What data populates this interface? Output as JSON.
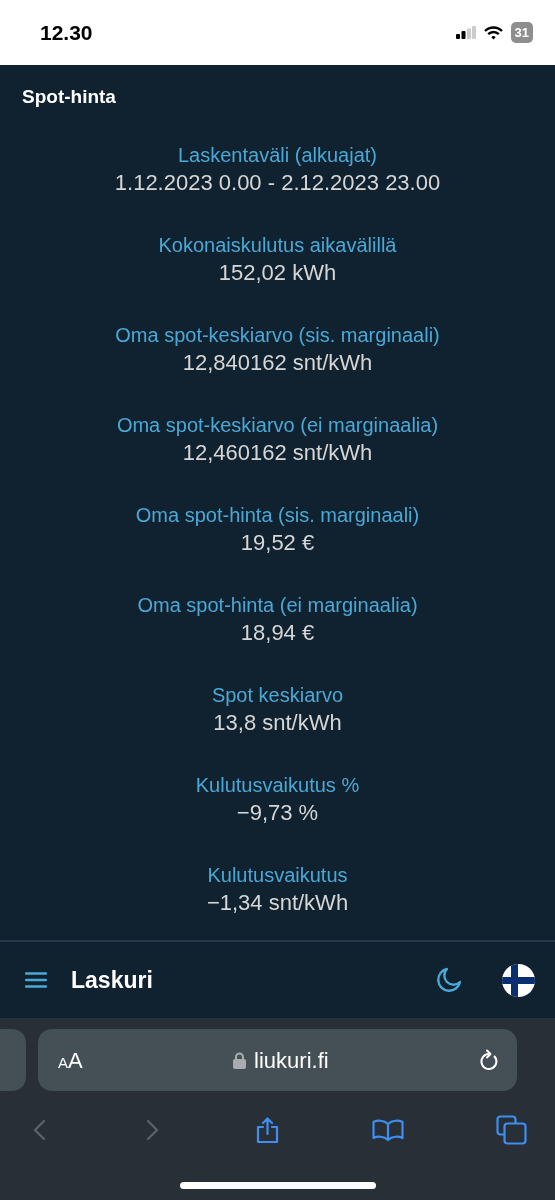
{
  "status_bar": {
    "time": "12.30",
    "battery": "31"
  },
  "page_title": "Spot-hinta",
  "stats": [
    {
      "label": "Laskentaväli (alkuajat)",
      "value": "1.12.2023 0.00 - 2.12.2023 23.00"
    },
    {
      "label": "Kokonaiskulutus aikavälillä",
      "value": "152,02 kWh"
    },
    {
      "label": "Oma spot-keskiarvo (sis. marginaali)",
      "value": "12,840162 snt/kWh"
    },
    {
      "label": "Oma spot-keskiarvo (ei marginaalia)",
      "value": "12,460162 snt/kWh"
    },
    {
      "label": "Oma spot-hinta (sis. marginaali)",
      "value": "19,52 €"
    },
    {
      "label": "Oma spot-hinta (ei marginaalia)",
      "value": "18,94 €"
    },
    {
      "label": "Spot keskiarvo",
      "value": "13,8 snt/kWh"
    },
    {
      "label": "Kulutusvaikutus %",
      "value": "−9,73 %"
    },
    {
      "label": "Kulutusvaikutus",
      "value": "−1,34 snt/kWh"
    }
  ],
  "navbar": {
    "title": "Laskuri"
  },
  "browser": {
    "text_size": "AA",
    "url": "liukuri.fi",
    "toolbar": [
      {
        "kind": "back",
        "disabled": true
      },
      {
        "kind": "forward",
        "disabled": true
      },
      {
        "kind": "share",
        "disabled": false
      },
      {
        "kind": "bookmarks",
        "disabled": false
      },
      {
        "kind": "tabs",
        "disabled": false
      }
    ]
  }
}
